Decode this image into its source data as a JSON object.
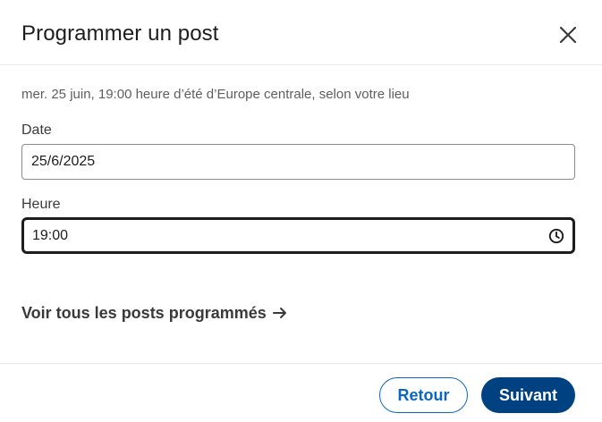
{
  "dialog": {
    "title": "Programmer un post",
    "close_icon": "close-icon"
  },
  "timezone_note": "mer. 25 juin, 19:00 heure d’été d’Europe centrale, selon votre lieu",
  "date_field": {
    "label": "Date",
    "value": "25/6/2025"
  },
  "time_field": {
    "label": "Heure",
    "value": "19:00",
    "icon": "clock-icon"
  },
  "all_posts_link": {
    "label": "Voir tous les posts programmés",
    "icon": "arrow-right-icon"
  },
  "footer": {
    "back_label": "Retour",
    "next_label": "Suivant"
  },
  "colors": {
    "primary": "#0a66c2",
    "primary_dark": "#004182",
    "text": "#1d1d1d",
    "muted": "#5e5e5e"
  }
}
